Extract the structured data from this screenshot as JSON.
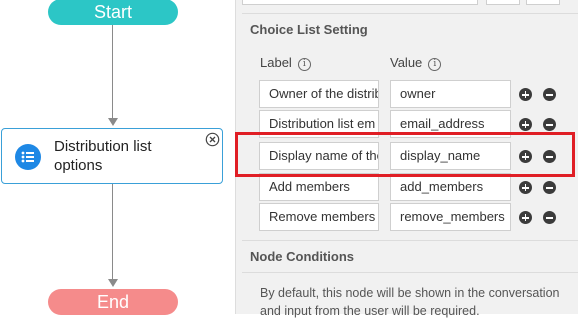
{
  "flow": {
    "start_label": "Start",
    "end_label": "End",
    "node": {
      "title": "Distribution list options",
      "icon": "list-icon",
      "close_icon": "close-circle-icon",
      "accent_color": "#1e88e5",
      "border_color": "#3aa0d8"
    },
    "start_color": "#2cc6c6",
    "end_color": "#f58b8b"
  },
  "panel": {
    "choice_section_title": "Choice List Setting",
    "label_header": "Label",
    "value_header": "Value",
    "info_icon": "i",
    "rows": [
      {
        "label": "Owner of the distrib",
        "value": "owner"
      },
      {
        "label": "Distribution list em",
        "value": "email_address"
      },
      {
        "label": "Display name of the",
        "value": "display_name"
      },
      {
        "label": "Add members",
        "value": "add_members"
      },
      {
        "label": "Remove members",
        "value": "remove_members"
      }
    ],
    "conditions_section_title": "Node Conditions",
    "conditions_text": "By default, this node will be shown in the conversation and input from the user will be required.",
    "highlight_color": "#e01e25"
  }
}
